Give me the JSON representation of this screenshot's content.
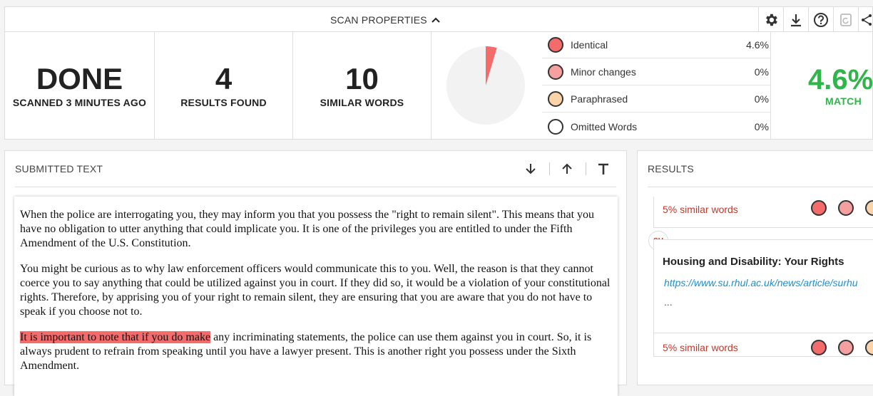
{
  "header": {
    "title": "SCAN PROPERTIES",
    "tools": [
      "gear-icon",
      "download-icon",
      "help-icon",
      "refresh-icon",
      "share-icon"
    ]
  },
  "stats": {
    "status": {
      "value": "DONE",
      "label": "SCANNED 3 MINUTES AGO"
    },
    "results": {
      "value": "4",
      "label": "RESULTS FOUND"
    },
    "words": {
      "value": "10",
      "label": "SIMILAR WORDS"
    }
  },
  "chart_data": {
    "type": "pie",
    "categories": [
      "Identical",
      "Minor changes",
      "Paraphrased",
      "Omitted Words"
    ],
    "values": [
      4.6,
      0,
      0,
      0
    ],
    "colors": [
      "#f46b6b",
      "#f4a0a0",
      "#f9d3a8",
      "#ffffff"
    ],
    "remainder_color": "#f2f2f2"
  },
  "legend": [
    {
      "label": "Identical",
      "value": "4.6%",
      "color": "#f46b6b"
    },
    {
      "label": "Minor changes",
      "value": "0%",
      "color": "#f6a0a0"
    },
    {
      "label": "Paraphrased",
      "value": "0%",
      "color": "#fad4a8"
    },
    {
      "label": "Omitted Words",
      "value": "0%",
      "color": "#ffffff"
    }
  ],
  "match": {
    "value": "4.6%",
    "label": "MATCH",
    "color": "#2fb549"
  },
  "submitted": {
    "title": "SUBMITTED TEXT",
    "p1": "When the police are interrogating you, they may inform you that you possess the \"right to remain silent\". This means that you have no obligation to utter anything that could implicate you. It is one of the privileges you are entitled to under the Fifth Amendment of the U.S. Constitution.",
    "p2": "You might be curious as to why law enforcement officers would communicate this to you. Well, the reason is that they cannot coerce you to say anything that could be utilized against you in court. If they did so, it would be a violation of your constitutional rights. Therefore, by apprising you of your right to remain silent, they are ensuring that you are aware that you do not have to speak if you choose not to.",
    "p3_highlight": "It is important to note that if you do make",
    "p3_rest": " any incriminating statements, the police can use them against you in court. So, it is always prudent to refrain from speaking until you have a lawyer present. This is another right you possess under the Sixth Amendment."
  },
  "results": {
    "title": "RESULTS",
    "items": [
      {
        "similar": "5% similar words"
      },
      {
        "source_icon": "SU",
        "title": "Housing and Disability: Your Rights",
        "url": "https://www.su.rhul.ac.uk/news/article/surhu",
        "excerpt": "...",
        "similar": "5% similar words"
      }
    ]
  }
}
